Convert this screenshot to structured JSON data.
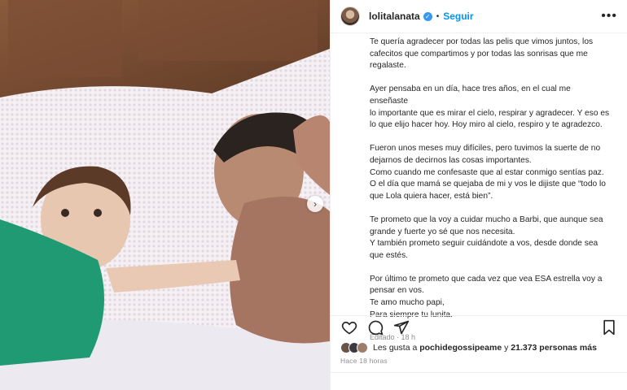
{
  "header": {
    "username": "lolitalanata",
    "follow_label": "Seguir",
    "separator": "•",
    "more_label": "•••",
    "verified_glyph": "✓"
  },
  "caption": {
    "paragraphs": [
      [
        "Te quería agradecer por todas las pelis que vimos juntos, los",
        "cafecitos que compartimos y por todas las sonrisas que me",
        "regalaste."
      ],
      [
        "Ayer pensaba en un día, hace tres años, en el cual me enseñaste",
        "lo importante que es mirar el cielo, respirar y agradecer. Y eso es",
        "lo que elijo hacer hoy. Hoy miro al cielo, respiro y te agradezco."
      ],
      [
        "Fueron unos meses muy difíciles, pero tuvimos la suerte de no",
        "dejarnos de decirnos las cosas importantes.",
        "Como cuando me confesaste que al estar conmigo sentías paz.",
        "O el día que mamá se quejaba de mi y vos le dijiste que “todo lo",
        "que Lola quiera hacer, está bien”."
      ],
      [
        "Te prometo que la voy a cuidar mucho a Barbi, que aunque sea",
        "grande y fuerte yo sé que nos necesita.",
        "Y también prometo seguir cuidándote a vos, desde donde sea",
        "que estés."
      ],
      [
        "Por último te prometo que cada vez que vea ESA estrella voy a",
        "pensar en vos.",
        "Te amo mucho papi,",
        "Para siempre tu lunita."
      ]
    ],
    "edited": "Editado · 18 h"
  },
  "likes": {
    "prefix": "Les gusta a",
    "user": "pochidegossipeame",
    "middle": "y",
    "count": "21.373 personas más"
  },
  "timestamp": "Hace 18 horas",
  "photo": {
    "next_glyph": "›"
  },
  "icons": {
    "heart": "heart-icon",
    "comment": "comment-icon",
    "share": "share-icon",
    "save": "bookmark-icon",
    "verified": "verified-badge-icon",
    "more": "more-options-icon",
    "next": "chevron-right-icon"
  },
  "colors": {
    "accent": "#0095f6",
    "verified": "#3897f0",
    "text": "#262626",
    "muted": "#8e8e8e"
  }
}
